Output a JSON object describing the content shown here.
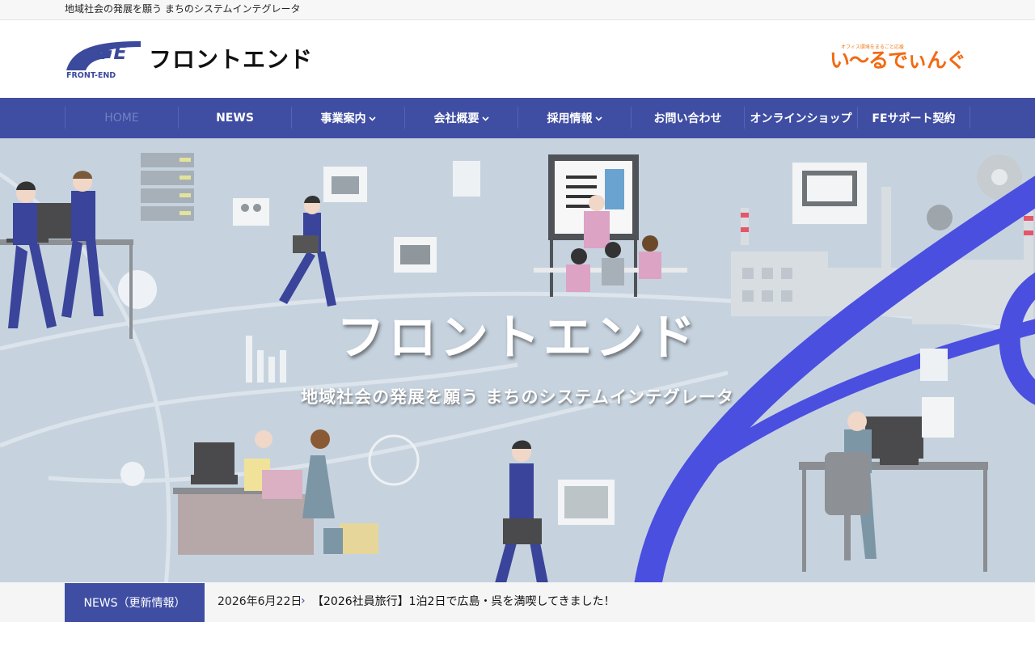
{
  "topbar": {
    "tagline": "地域社会の発展を願う まちのシステムインテグレータ"
  },
  "header": {
    "logo": {
      "mark": "FE",
      "sub": "FRONT-END",
      "wordmark": "フロントエンド"
    },
    "partner": {
      "slogan": "オフィス環境をまるごと応援",
      "name": "い〜るでぃんぐ"
    }
  },
  "nav": {
    "items": [
      {
        "label": "HOME",
        "active": true,
        "dropdown": false
      },
      {
        "label": "NEWS",
        "active": false,
        "dropdown": false
      },
      {
        "label": "事業案内",
        "active": false,
        "dropdown": true
      },
      {
        "label": "会社概要",
        "active": false,
        "dropdown": true
      },
      {
        "label": "採用情報",
        "active": false,
        "dropdown": true
      },
      {
        "label": "お問い合わせ",
        "active": false,
        "dropdown": false
      },
      {
        "label": "オンラインショップ",
        "active": false,
        "dropdown": false
      },
      {
        "label": "FEサポート契約",
        "active": false,
        "dropdown": false
      }
    ]
  },
  "hero": {
    "title": "フロントエンド",
    "subtitle": "地域社会の発展を願う まちのシステムインテグレータ"
  },
  "news": {
    "label": "NEWS（更新情報）",
    "date": "2026年6月22日",
    "headline": "【2026社員旅行】1泊2日で広島・呉を満喫してきました！"
  },
  "colors": {
    "brand": "#3f4ea3",
    "accent_orange": "#f26a12",
    "hero_bg": "#c6d3df",
    "arc": "#4a4fe0"
  },
  "icons": {
    "dropdown": "chevron-down-icon",
    "news_arrow": "chevron-right-icon"
  }
}
